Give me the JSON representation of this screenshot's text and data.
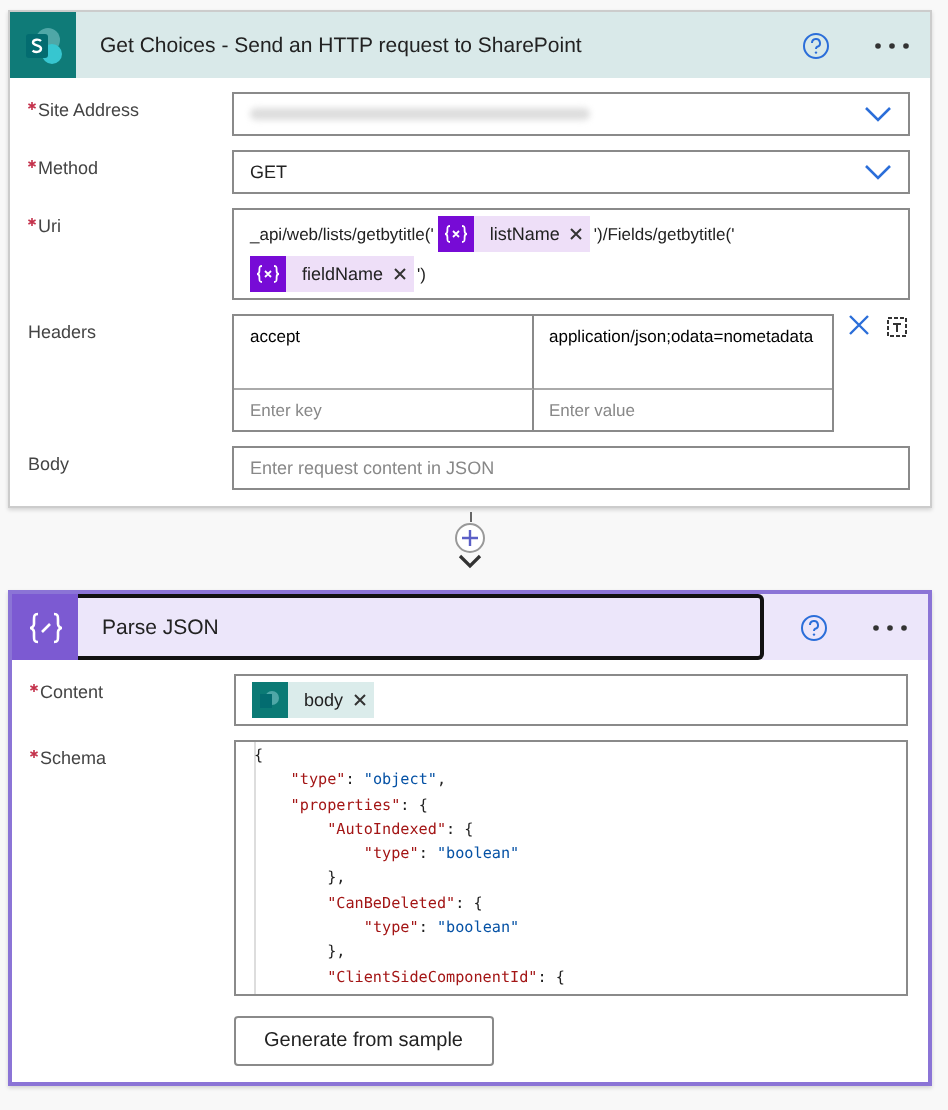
{
  "actions": [
    {
      "kind": "sharepoint",
      "title": "Get Choices - Send an HTTP request to SharePoint",
      "selected": false,
      "fields": [
        {
          "kind": "dropdown",
          "label": "Site Address",
          "required": true,
          "value_blurred": true
        },
        {
          "kind": "dropdown",
          "label": "Method",
          "required": true,
          "value": "GET"
        },
        {
          "kind": "tokens",
          "label": "Uri",
          "required": true,
          "parts": [
            {
              "kind": "text",
              "text": "_api/web/lists/getbytitle('"
            },
            {
              "kind": "variable",
              "text": "listName"
            },
            {
              "kind": "text",
              "text": "')/Fields/getbytitle('"
            },
            {
              "kind": "variable",
              "text": "fieldName"
            },
            {
              "kind": "text",
              "text": "')"
            }
          ]
        },
        {
          "kind": "headers",
          "label": "Headers",
          "required": false,
          "rows": [
            {
              "key": "accept",
              "value": "application/json;odata=nometadata"
            }
          ],
          "key_placeholder": "Enter key",
          "value_placeholder": "Enter value"
        },
        {
          "kind": "text",
          "label": "Body",
          "required": false,
          "placeholder": "Enter request content in JSON"
        }
      ]
    },
    {
      "kind": "parse_json",
      "title": "Parse JSON",
      "selected": true,
      "fields": [
        {
          "kind": "tokens",
          "label": "Content",
          "required": true,
          "parts": [
            {
              "kind": "output",
              "text": "body"
            }
          ]
        },
        {
          "kind": "code",
          "label": "Schema",
          "required": true,
          "lines": [
            "{",
            "    \"type\": \"object\",",
            "    \"properties\": {",
            "        \"AutoIndexed\": {",
            "            \"type\": \"boolean\"",
            "        },",
            "        \"CanBeDeleted\": {",
            "            \"type\": \"boolean\"",
            "        },",
            "        \"ClientSideComponentId\": {"
          ]
        }
      ],
      "button": "Generate from sample"
    }
  ]
}
